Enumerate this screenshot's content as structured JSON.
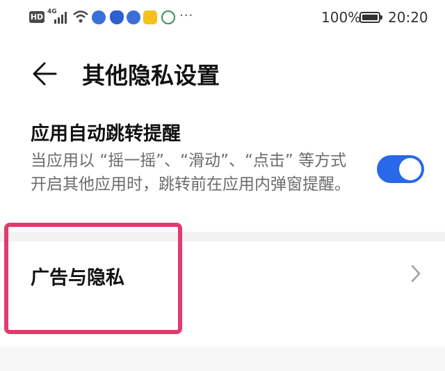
{
  "status_bar": {
    "hd": "HD",
    "network": "4G",
    "dots": "···",
    "battery_percent": "100%",
    "time": "20:20"
  },
  "header": {
    "title": "其他隐私设置"
  },
  "settings": {
    "auto_jump": {
      "title": "应用自动跳转提醒",
      "description": "当应用以 “摇一摇”、“滑动”、“点击” 等方式开启其他应用时，跳转前在应用内弹窗提醒。",
      "enabled": true
    },
    "ads_privacy": {
      "label": "广告与隐私"
    }
  },
  "colors": {
    "toggle_on": "#2968e8",
    "highlight": "#e03b6f"
  }
}
